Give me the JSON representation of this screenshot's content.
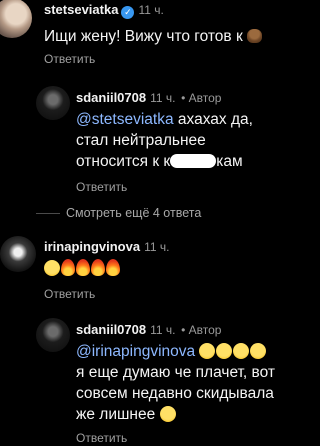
{
  "comments": [
    {
      "username": "stetseviatka",
      "time": "11 ч.",
      "text": "Ищи жену! Вижу что готов к",
      "reply_label": "Ответить"
    },
    {
      "username": "sdaniil0708",
      "time": "11 ч.",
      "author_label": "• Автор",
      "mention": "@stetseviatka",
      "text_line1": " ахахах да,",
      "text_line2": "стал нейтральнее",
      "text_line3_start": "относится к к",
      "text_line3_end": "кам",
      "reply_label": "Ответить"
    },
    {
      "more_replies": "Смотреть ещё 4 ответа"
    },
    {
      "username": "irinapingvinova",
      "time": "11 ч.",
      "reply_label": "Ответить"
    },
    {
      "username": "sdaniil0708",
      "time": "11 ч.",
      "author_label": "• Автор",
      "mention": "@irinapingvinova",
      "text_line2": "я еще думаю че плачет, вот",
      "text_line3": "совсем недавно скидывала",
      "text_line4": "же лишнее",
      "reply_label": "Ответить"
    }
  ],
  "icons": {
    "verified": "verified-badge-icon",
    "poop": "poop-emoji",
    "laugh": "tears-of-joy-emoji",
    "fire": "fire-emoji"
  },
  "colors": {
    "background": "#000000",
    "mention": "#8db8ff",
    "verified": "#3897f0"
  }
}
